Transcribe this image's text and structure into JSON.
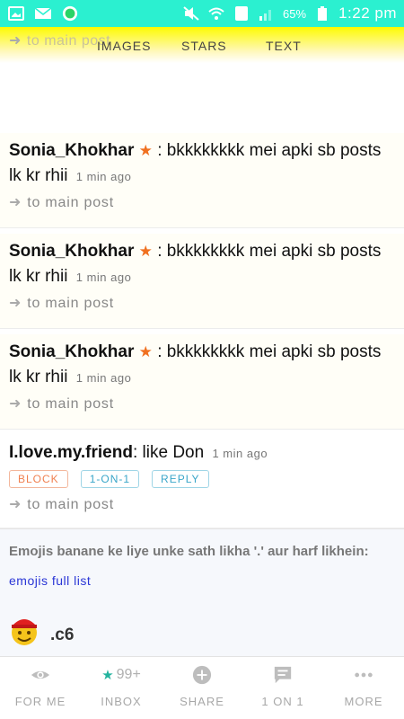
{
  "status_bar": {
    "battery": "65%",
    "time": "1:22 pm",
    "sim": "1"
  },
  "header": {
    "ghost_link": "to main post",
    "tabs": [
      "IMAGES",
      "STARS",
      "TEXT"
    ]
  },
  "comments": [
    {
      "user": "Sonia_Khokhar",
      "starred": true,
      "text": ": bkkkkkkkk mei apki sb posts lk kr rhii",
      "time": "1 min ago",
      "link": "to main post"
    },
    {
      "user": "Sonia_Khokhar",
      "starred": true,
      "text": ": bkkkkkkkk mei apki sb posts lk kr rhii",
      "time": "1 min ago",
      "link": "to main post"
    },
    {
      "user": "Sonia_Khokhar",
      "starred": true,
      "text": ": bkkkkkkkk mei apki sb posts lk kr rhii",
      "time": "1 min ago",
      "link": "to main post"
    },
    {
      "user": "I.love.my.friend",
      "starred": false,
      "text": ": like Don",
      "time": "1 min ago",
      "actions": [
        "BLOCK",
        "1-ON-1",
        "REPLY"
      ],
      "link": "to main post"
    }
  ],
  "emoji_help": {
    "text": "Emojis banane ke liye unke sath likha '.' aur harf likhein:",
    "link": "emojis full list",
    "user_name": ".c6"
  },
  "bottom_nav": [
    {
      "label": "FOR ME",
      "icon": "eye-icon"
    },
    {
      "label": "INBOX",
      "icon": "star-icon",
      "count": "99+"
    },
    {
      "label": "SHARE",
      "icon": "plus-circle-icon"
    },
    {
      "label": "1 ON 1",
      "icon": "chat-icon"
    },
    {
      "label": "MORE",
      "icon": "more-dots-icon"
    }
  ],
  "colors": {
    "status_bar": "#2bf0d0",
    "header_yellow": "#fdfa00",
    "star_orange": "#f07020",
    "link_blue": "#2a36d6",
    "inbox_star": "#22b39e"
  }
}
